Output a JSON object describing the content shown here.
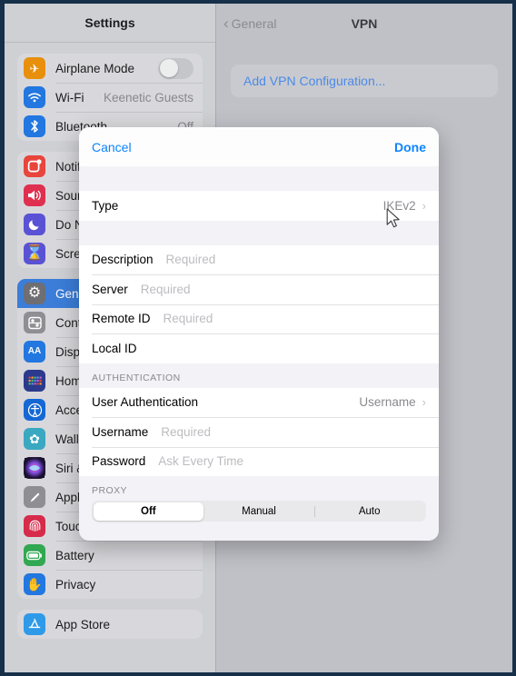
{
  "sidebar": {
    "title": "Settings",
    "groups": [
      {
        "items": [
          {
            "label": "Airplane Mode",
            "icon": "airplane-icon",
            "control": "toggle",
            "toggle_on": false,
            "value": ""
          },
          {
            "label": "Wi-Fi",
            "icon": "wifi-icon",
            "control": "value",
            "value": "Keenetic Guests"
          },
          {
            "label": "Bluetooth",
            "icon": "bluetooth-icon",
            "control": "value",
            "value": "Off"
          }
        ]
      },
      {
        "items": [
          {
            "label": "Notifications",
            "icon": "notifications-icon",
            "control": "none",
            "value": ""
          },
          {
            "label": "Sounds",
            "icon": "sounds-icon",
            "control": "none",
            "value": ""
          },
          {
            "label": "Do Not Disturb",
            "icon": "do-not-disturb-icon",
            "control": "none",
            "value": ""
          },
          {
            "label": "Screen Time",
            "icon": "screen-time-icon",
            "control": "none",
            "value": ""
          }
        ]
      },
      {
        "items": [
          {
            "label": "General",
            "icon": "gear-icon",
            "control": "none",
            "value": "",
            "selected": true
          },
          {
            "label": "Control Center",
            "icon": "control-center-icon",
            "control": "none",
            "value": ""
          },
          {
            "label": "Display & Brightness",
            "icon": "display-icon",
            "control": "none",
            "value": ""
          },
          {
            "label": "Home Screen & Dock",
            "icon": "home-screen-icon",
            "control": "none",
            "value": ""
          },
          {
            "label": "Accessibility",
            "icon": "accessibility-icon",
            "control": "none",
            "value": ""
          },
          {
            "label": "Wallpaper",
            "icon": "wallpaper-icon",
            "control": "none",
            "value": ""
          },
          {
            "label": "Siri & Search",
            "icon": "siri-icon",
            "control": "none",
            "value": ""
          },
          {
            "label": "Apple Pencil",
            "icon": "apple-pencil-icon",
            "control": "none",
            "value": ""
          },
          {
            "label": "Touch ID & Passcode",
            "icon": "touch-id-icon",
            "control": "none",
            "value": ""
          },
          {
            "label": "Battery",
            "icon": "battery-icon",
            "control": "none",
            "value": ""
          },
          {
            "label": "Privacy",
            "icon": "privacy-icon",
            "control": "none",
            "value": ""
          }
        ]
      },
      {
        "items": [
          {
            "label": "App Store",
            "icon": "app-store-icon",
            "control": "none",
            "value": ""
          }
        ]
      }
    ]
  },
  "detail": {
    "back_label": "General",
    "title": "VPN",
    "add_vpn_label": "Add VPN Configuration..."
  },
  "modal": {
    "cancel_label": "Cancel",
    "done_label": "Done",
    "type_row": {
      "label": "Type",
      "value": "IKEv2"
    },
    "fields": [
      {
        "label": "Description",
        "placeholder": "Required"
      },
      {
        "label": "Server",
        "placeholder": "Required"
      },
      {
        "label": "Remote ID",
        "placeholder": "Required"
      },
      {
        "label": "Local ID",
        "placeholder": ""
      }
    ],
    "auth_header": "AUTHENTICATION",
    "auth_rows": [
      {
        "label": "User Authentication",
        "value": "Username",
        "type": "nav"
      },
      {
        "label": "Username",
        "placeholder": "Required",
        "type": "input"
      },
      {
        "label": "Password",
        "placeholder": "Ask Every Time",
        "type": "input"
      }
    ],
    "proxy_header": "PROXY",
    "proxy_options": [
      {
        "label": "Off",
        "active": true
      },
      {
        "label": "Manual",
        "active": false
      },
      {
        "label": "Auto",
        "active": false
      }
    ]
  },
  "colors": {
    "accent_blue": "#0a84ff",
    "selected_row": "#3b7dd8",
    "frame": "#16304a",
    "panel_bg": "#c0c1c7"
  }
}
